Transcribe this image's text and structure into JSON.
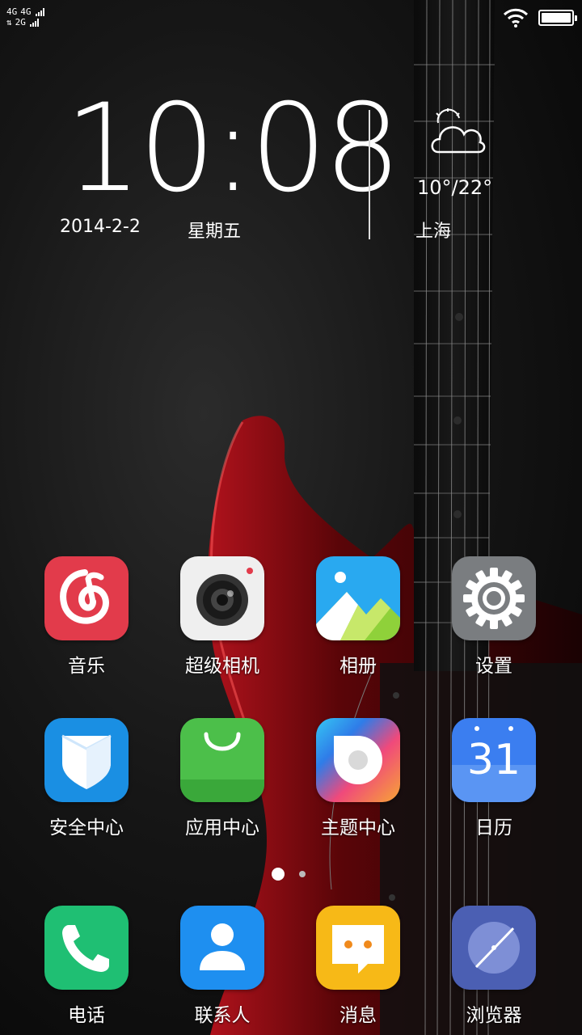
{
  "status_bar": {
    "row1_left": "4G",
    "row1_right": "4G",
    "row2_left": "⇅",
    "row2_right": "2G"
  },
  "clock": {
    "time": "10:08",
    "date": "2014-2-2",
    "weekday": "星期五"
  },
  "weather": {
    "temperature": "10°/22°",
    "city": "上海",
    "icon": "partly-cloudy-icon"
  },
  "apps": [
    {
      "label": "音乐",
      "icon": "music-icon",
      "color": "#e23b4b"
    },
    {
      "label": "超级相机",
      "icon": "camera-icon",
      "color": "#efefef"
    },
    {
      "label": "相册",
      "icon": "gallery-icon",
      "color": "#29a9f0"
    },
    {
      "label": "设置",
      "icon": "settings-gear-icon",
      "color": "#7a7d80"
    },
    {
      "label": "安全中心",
      "icon": "shield-icon",
      "color": "#1a8fe3"
    },
    {
      "label": "应用中心",
      "icon": "shopping-bag-icon",
      "color": "#4cbf4a"
    },
    {
      "label": "主题中心",
      "icon": "theme-icon",
      "color": "#f05a4a"
    },
    {
      "label": "日历",
      "icon": "calendar-icon",
      "color": "#3b7ef0"
    }
  ],
  "calendar_day": "31",
  "page_indicator": {
    "pages": 2,
    "current": 1
  },
  "dock": [
    {
      "label": "电话",
      "icon": "phone-icon",
      "color": "#1fbf73"
    },
    {
      "label": "联系人",
      "icon": "contacts-icon",
      "color": "#1e8ff0"
    },
    {
      "label": "消息",
      "icon": "message-icon",
      "color": "#f7b917"
    },
    {
      "label": "浏览器",
      "icon": "browser-compass-icon",
      "color": "#4b5fb3"
    }
  ]
}
